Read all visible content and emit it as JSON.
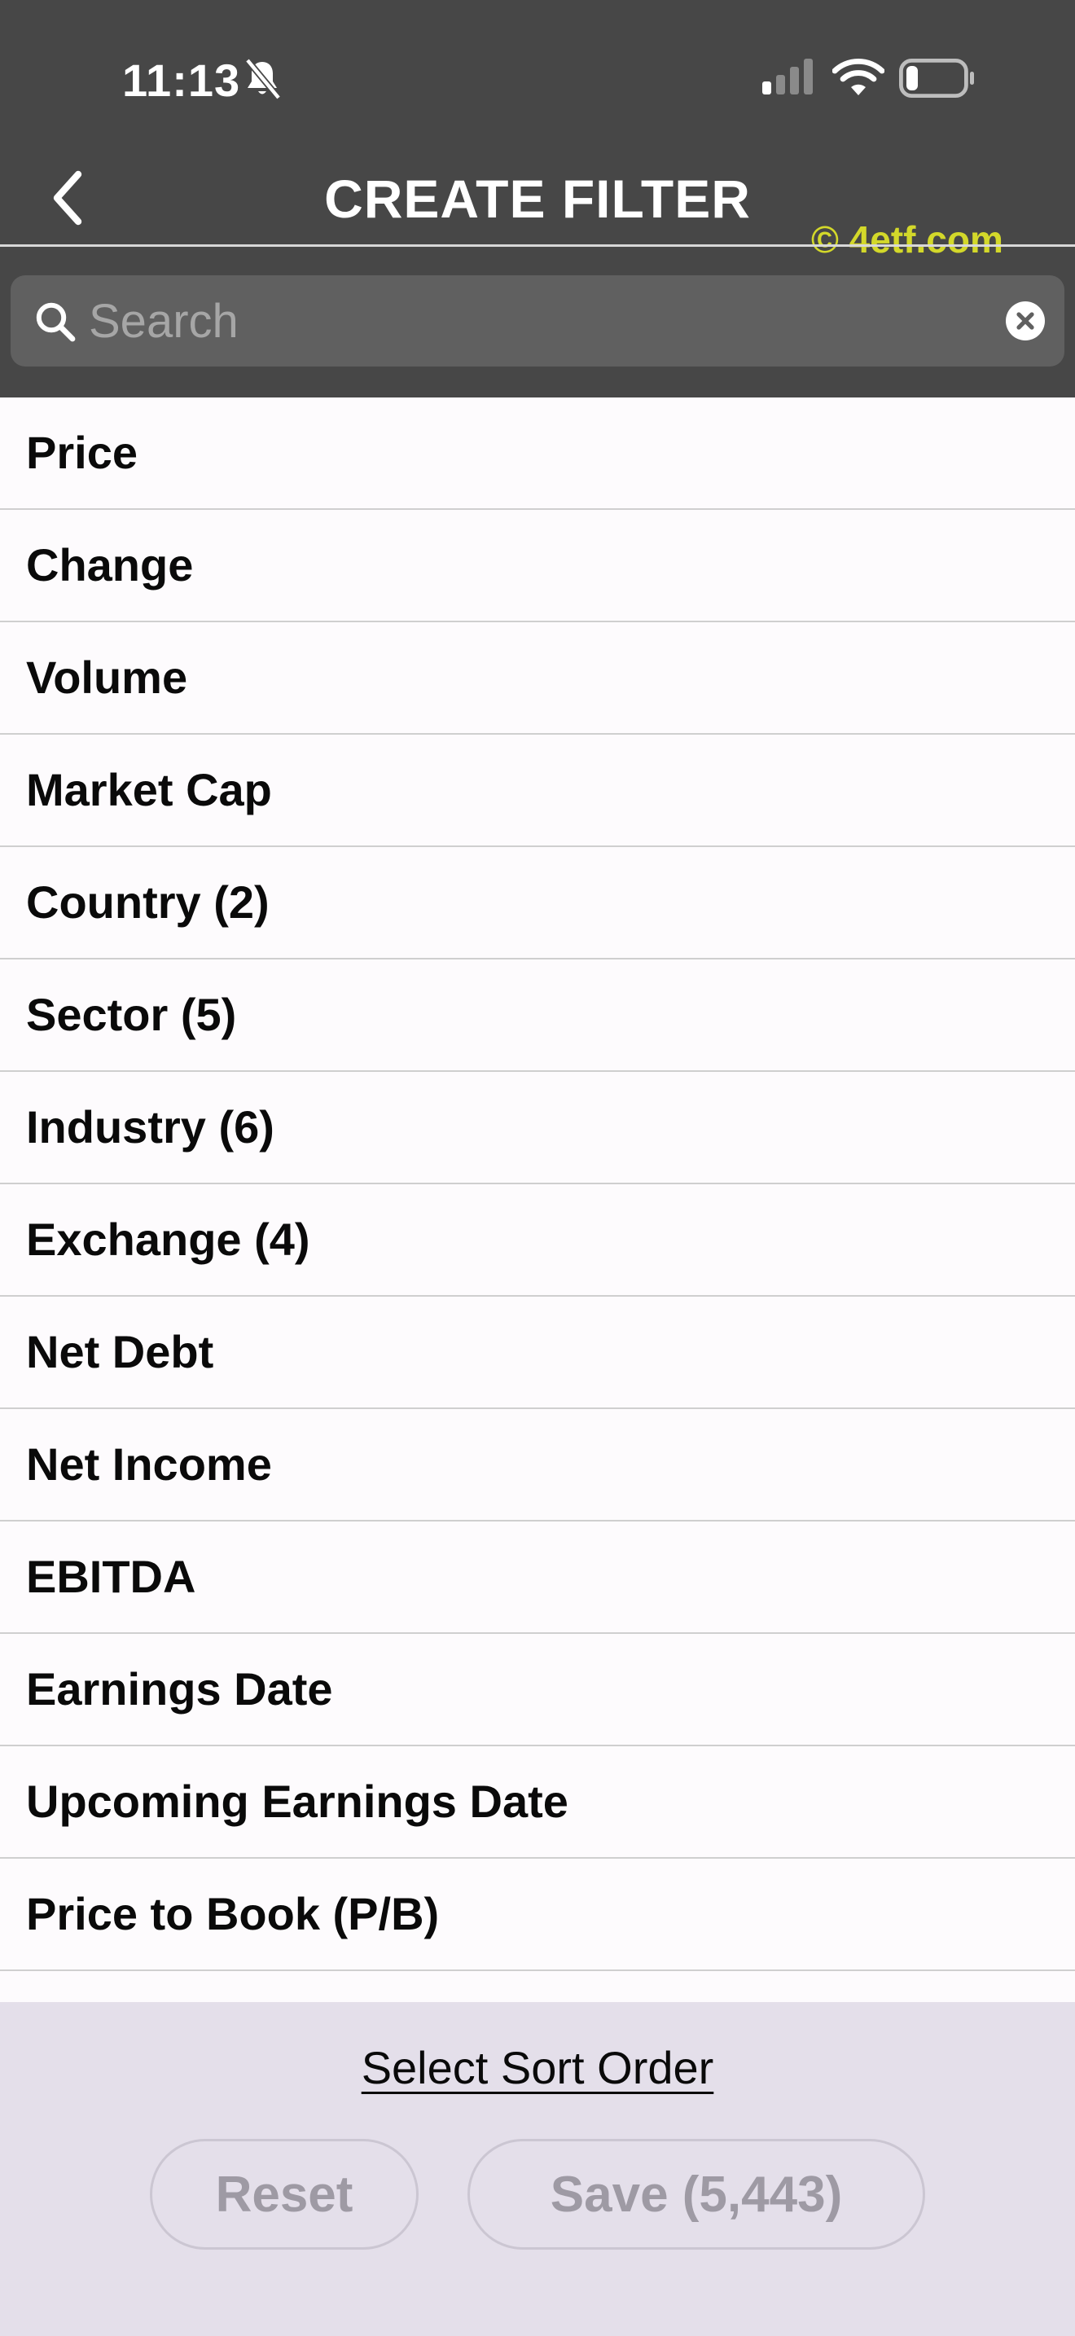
{
  "status_bar": {
    "time": "11:13",
    "icons": [
      "bell-slash-icon",
      "signal-icon",
      "wifi-icon",
      "battery-icon"
    ]
  },
  "header": {
    "title": "CREATE FILTER",
    "back_icon": "chevron-left-icon",
    "watermark": "© 4etf.com"
  },
  "search": {
    "placeholder": "Search",
    "value": ""
  },
  "filters": [
    {
      "label": "Price"
    },
    {
      "label": "Change"
    },
    {
      "label": "Volume"
    },
    {
      "label": "Market Cap"
    },
    {
      "label": "Country (2)"
    },
    {
      "label": "Sector (5)"
    },
    {
      "label": "Industry (6)"
    },
    {
      "label": "Exchange (4)"
    },
    {
      "label": "Net Debt"
    },
    {
      "label": "Net Income"
    },
    {
      "label": "EBITDA"
    },
    {
      "label": "Earnings Date"
    },
    {
      "label": "Upcoming Earnings Date"
    },
    {
      "label": "Price to Book (P/B)"
    }
  ],
  "footer": {
    "sort_link": "Select Sort Order",
    "reset_label": "Reset",
    "save_label": "Save (5,443)"
  },
  "colors": {
    "header_bg": "#474747",
    "search_bg": "#606060",
    "list_bg": "#fdfbfd",
    "footer_bg": "#e4dfea",
    "watermark": "#d3d82a",
    "disabled_text": "#9e9aa4"
  }
}
